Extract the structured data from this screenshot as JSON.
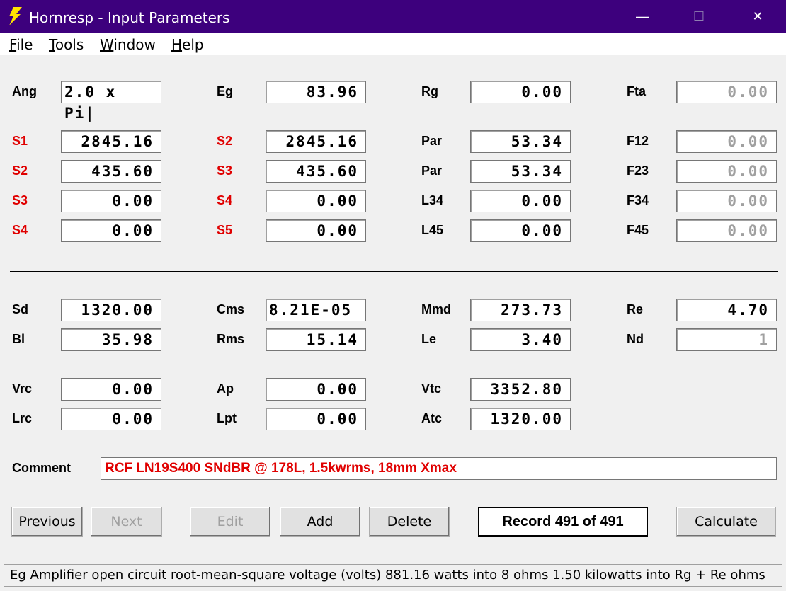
{
  "window": {
    "title": "Hornresp - Input Parameters",
    "minimize": "—",
    "maximize": "☐",
    "close": "✕"
  },
  "menu": [
    {
      "first": "F",
      "rest": "ile"
    },
    {
      "first": "T",
      "rest": "ools"
    },
    {
      "first": "W",
      "rest": "indow"
    },
    {
      "first": "H",
      "rest": "elp"
    }
  ],
  "params": {
    "ang": {
      "label": "Ang",
      "value": "2.0 x Pi|"
    },
    "eg": {
      "label": "Eg",
      "value": "83.96"
    },
    "rg": {
      "label": "Rg",
      "value": "0.00"
    },
    "fta": {
      "label": "Fta",
      "value": "0.00"
    },
    "s1": {
      "label": "S1",
      "value": "2845.16"
    },
    "s2_a": {
      "label": "S2",
      "value": "2845.16"
    },
    "par1": {
      "label": "Par",
      "value": "53.34"
    },
    "f12": {
      "label": "F12",
      "value": "0.00"
    },
    "s2_b": {
      "label": "S2",
      "value": "435.60"
    },
    "s3_a": {
      "label": "S3",
      "value": "435.60"
    },
    "par2": {
      "label": "Par",
      "value": "53.34"
    },
    "f23": {
      "label": "F23",
      "value": "0.00"
    },
    "s3_b": {
      "label": "S3",
      "value": "0.00"
    },
    "s4_a": {
      "label": "S4",
      "value": "0.00"
    },
    "l34": {
      "label": "L34",
      "value": "0.00"
    },
    "f34": {
      "label": "F34",
      "value": "0.00"
    },
    "s4_b": {
      "label": "S4",
      "value": "0.00"
    },
    "s5": {
      "label": "S5",
      "value": "0.00"
    },
    "l45": {
      "label": "L45",
      "value": "0.00"
    },
    "f45": {
      "label": "F45",
      "value": "0.00"
    },
    "sd": {
      "label": "Sd",
      "value": "1320.00"
    },
    "cms": {
      "label": "Cms",
      "value": "8.21E-05"
    },
    "mmd": {
      "label": "Mmd",
      "value": "273.73"
    },
    "re": {
      "label": "Re",
      "value": "4.70"
    },
    "bl": {
      "label": "Bl",
      "value": "35.98"
    },
    "rms": {
      "label": "Rms",
      "value": "15.14"
    },
    "le": {
      "label": "Le",
      "value": "3.40"
    },
    "nd": {
      "label": "Nd",
      "value": "1"
    },
    "vrc": {
      "label": "Vrc",
      "value": "0.00"
    },
    "ap": {
      "label": "Ap",
      "value": "0.00"
    },
    "vtc": {
      "label": "Vtc",
      "value": "3352.80"
    },
    "lrc": {
      "label": "Lrc",
      "value": "0.00"
    },
    "lpt": {
      "label": "Lpt",
      "value": "0.00"
    },
    "atc": {
      "label": "Atc",
      "value": "1320.00"
    }
  },
  "comment": {
    "label": "Comment",
    "value": "RCF LN19S400 SNdBR @ 178L, 1.5kwrms, 18mm Xmax"
  },
  "buttons": {
    "previous": {
      "first": "P",
      "rest": "revious"
    },
    "next": {
      "first": "N",
      "rest": "ext"
    },
    "edit": {
      "first": "E",
      "rest": "dit"
    },
    "add": {
      "first": "A",
      "rest": "dd"
    },
    "delete": {
      "first": "D",
      "rest": "elete"
    },
    "calculate": {
      "first": "C",
      "rest": "alculate"
    }
  },
  "record": "Record 491 of 491",
  "status": "Eg  Amplifier open circuit root-mean-square voltage  (volts)  881.16 watts into 8 ohms   1.50 kilowatts into Rg + Re ohms",
  "colors": {
    "titlebar": "#3d007d",
    "red_label": "#e00000",
    "disabled": "#a0a0a0"
  }
}
